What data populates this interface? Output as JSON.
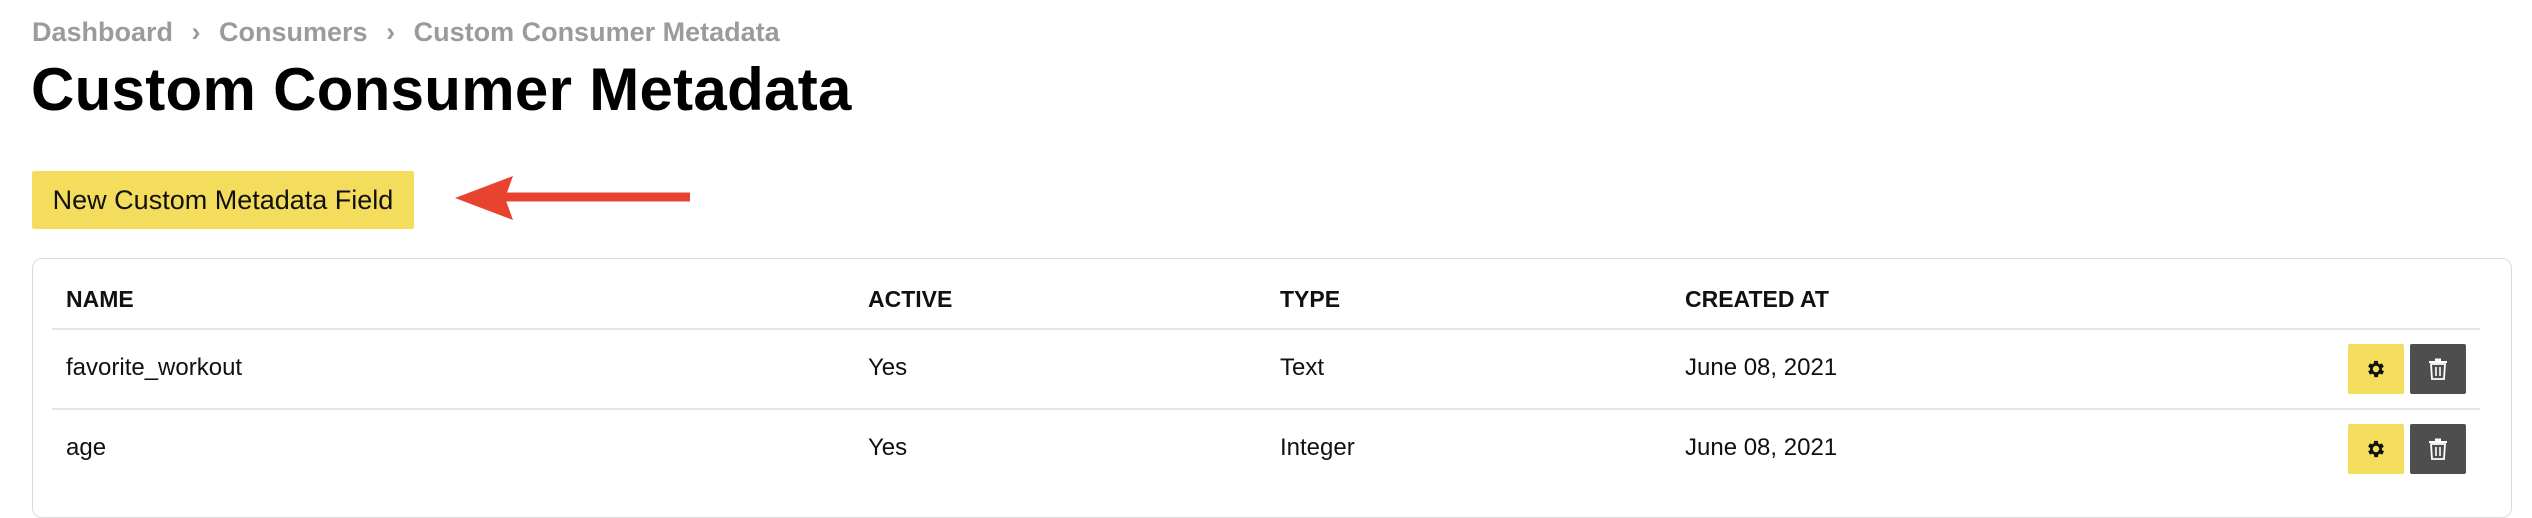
{
  "breadcrumb": {
    "items": [
      "Dashboard",
      "Consumers",
      "Custom Consumer Metadata"
    ],
    "separator": "›"
  },
  "page": {
    "title": "Custom Consumer Metadata"
  },
  "toolbar": {
    "new_field_label": "New Custom Metadata Field"
  },
  "table": {
    "headers": {
      "name": "NAME",
      "active": "ACTIVE",
      "type": "TYPE",
      "created_at": "CREATED AT"
    },
    "rows": [
      {
        "name": "favorite_workout",
        "active": "Yes",
        "type": "Text",
        "created_at": "June 08, 2021"
      },
      {
        "name": "age",
        "active": "Yes",
        "type": "Integer",
        "created_at": "June 08, 2021"
      }
    ],
    "row_actions": {
      "settings_icon": "gear-icon",
      "delete_icon": "trash-icon"
    }
  },
  "annotation": {
    "arrow_color": "#e8432f"
  },
  "colors": {
    "accent_yellow": "#f4dc5c",
    "dark_button": "#4e4e4e",
    "breadcrumb_gray": "#9b9b9b"
  }
}
